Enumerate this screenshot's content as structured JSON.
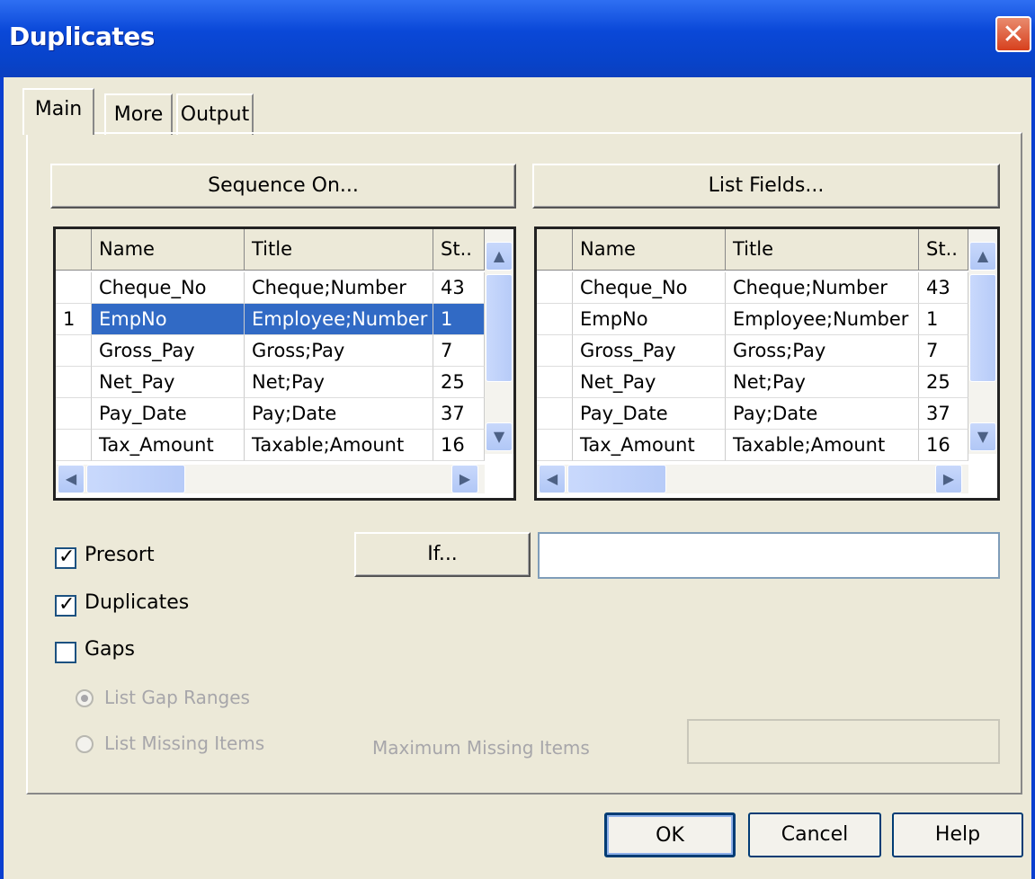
{
  "window": {
    "title": "Duplicates"
  },
  "tabs": [
    {
      "label": "Main",
      "active": true
    },
    {
      "label": "More",
      "active": false
    },
    {
      "label": "Output",
      "active": false
    }
  ],
  "main": {
    "sequence_button": "Sequence On...",
    "list_fields_button": "List Fields...",
    "left_grid": {
      "columns": [
        "",
        "Name",
        "Title",
        "St.."
      ],
      "rows": [
        {
          "num": "",
          "name": "Cheque_No",
          "title": "Cheque;Number",
          "st": "43",
          "selected": false
        },
        {
          "num": "1",
          "name": "EmpNo",
          "title": "Employee;Number",
          "st": "1",
          "selected": true
        },
        {
          "num": "",
          "name": "Gross_Pay",
          "title": "Gross;Pay",
          "st": "7",
          "selected": false
        },
        {
          "num": "",
          "name": "Net_Pay",
          "title": "Net;Pay",
          "st": "25",
          "selected": false
        },
        {
          "num": "",
          "name": "Pay_Date",
          "title": "Pay;Date",
          "st": "37",
          "selected": false
        },
        {
          "num": "",
          "name": "Tax_Amount",
          "title": "Taxable;Amount",
          "st": "16",
          "selected": false
        }
      ]
    },
    "right_grid": {
      "columns": [
        "",
        "Name",
        "Title",
        "St.."
      ],
      "rows": [
        {
          "num": "",
          "name": "Cheque_No",
          "title": "Cheque;Number",
          "st": "43"
        },
        {
          "num": "",
          "name": "EmpNo",
          "title": "Employee;Number",
          "st": "1"
        },
        {
          "num": "",
          "name": "Gross_Pay",
          "title": "Gross;Pay",
          "st": "7"
        },
        {
          "num": "",
          "name": "Net_Pay",
          "title": "Net;Pay",
          "st": "25"
        },
        {
          "num": "",
          "name": "Pay_Date",
          "title": "Pay;Date",
          "st": "37"
        },
        {
          "num": "",
          "name": "Tax_Amount",
          "title": "Taxable;Amount",
          "st": "16"
        }
      ]
    },
    "presort": {
      "label": "Presort",
      "checked": true
    },
    "duplicates": {
      "label": "Duplicates",
      "checked": true
    },
    "gaps": {
      "label": "Gaps",
      "checked": false
    },
    "if_button": "If...",
    "if_value": "",
    "list_gap_ranges": {
      "label": "List Gap Ranges",
      "selected": true
    },
    "list_missing_items": {
      "label": "List Missing Items",
      "selected": false
    },
    "maximum_missing_label": "Maximum Missing Items",
    "maximum_missing_value": ""
  },
  "footer": {
    "ok": "OK",
    "cancel": "Cancel",
    "help": "Help"
  }
}
